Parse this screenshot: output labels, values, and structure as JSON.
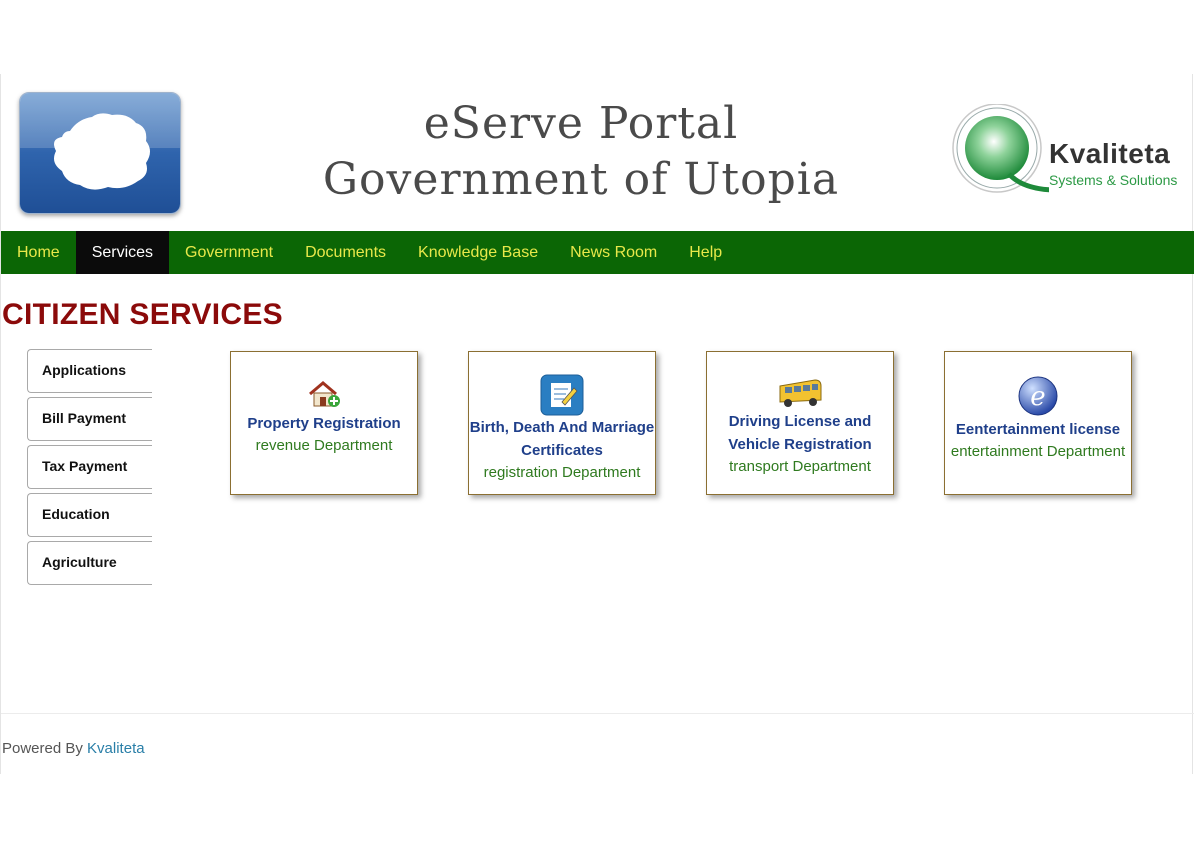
{
  "header": {
    "title_line1": "eServe Portal",
    "title_line2": "Government of Utopia",
    "logo_name": "Kvaliteta",
    "logo_tagline": "Systems & Solutions"
  },
  "nav": {
    "items": [
      "Home",
      "Services",
      "Government",
      "Documents",
      "Knowledge Base",
      "News Room",
      "Help"
    ],
    "active": "Services"
  },
  "section_title": "CITIZEN SERVICES",
  "side_tabs": [
    "Applications",
    "Bill Payment",
    "Tax Payment",
    "Education",
    "Agriculture"
  ],
  "cards": [
    {
      "title_line1": "Property Registration",
      "title_line2": "",
      "department": "revenue Department",
      "icon": "house-icon"
    },
    {
      "title_line1": "Birth, Death And Marriage",
      "title_line2": "Certificates",
      "department": "registration Department",
      "icon": "certificate-edit-icon"
    },
    {
      "title_line1": "Driving License and",
      "title_line2": "Vehicle Registration",
      "department": "transport Department",
      "icon": "bus-icon"
    },
    {
      "title_line1": "Eentertainment license",
      "title_line2": "",
      "department": "entertainment Department",
      "icon": "e-letter-icon"
    }
  ],
  "footer": {
    "prefix": "Powered By",
    "link": "Kvaliteta"
  },
  "colors": {
    "nav_bg": "#0b6605",
    "nav_text": "#e8e84a",
    "nav_active_bg": "#0b0b0b",
    "section_title": "#8b0a0a",
    "card_title": "#1f3f8a",
    "card_dept": "#2f7a1f"
  }
}
